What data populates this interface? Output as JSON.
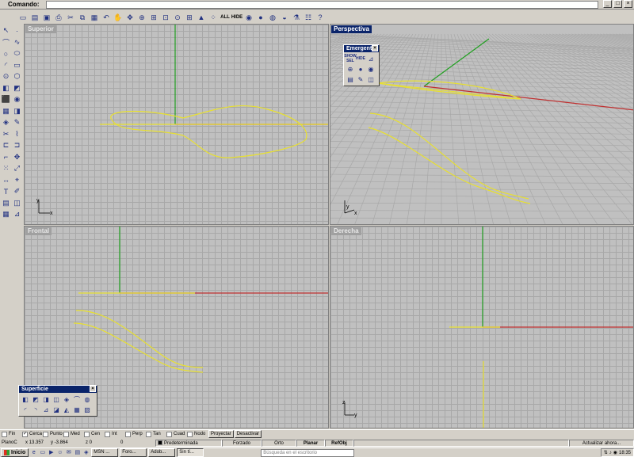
{
  "command": {
    "label": "Comando:",
    "value": ""
  },
  "window_buttons": [
    "_",
    "□",
    "×"
  ],
  "toolbar": {
    "icons": [
      {
        "name": "new-file-icon",
        "glyph": "▭"
      },
      {
        "name": "open-folder-icon",
        "glyph": "▤"
      },
      {
        "name": "save-icon",
        "glyph": "▣"
      },
      {
        "name": "print-icon",
        "glyph": "⎙"
      },
      {
        "name": "cut-icon",
        "glyph": "✂"
      },
      {
        "name": "copy-icon",
        "glyph": "⧉"
      },
      {
        "name": "paste-icon",
        "glyph": "▦"
      },
      {
        "name": "undo-icon",
        "glyph": "↶"
      },
      {
        "name": "pan-hand-icon",
        "glyph": "✋"
      },
      {
        "name": "rotate-view-icon",
        "glyph": "✥"
      },
      {
        "name": "zoom-icon",
        "glyph": "⊕"
      },
      {
        "name": "zoom-window-icon",
        "glyph": "⊞"
      },
      {
        "name": "zoom-extents-icon",
        "glyph": "⊡"
      },
      {
        "name": "zoom-selected-icon",
        "glyph": "⊙"
      },
      {
        "name": "viewport-layout-icon",
        "glyph": "⊞"
      },
      {
        "name": "select-car-icon",
        "glyph": "▲"
      },
      {
        "name": "select-points-icon",
        "glyph": "⁘"
      },
      {
        "name": "select-all-text",
        "text": "ALL"
      },
      {
        "name": "hide-text",
        "text": "HIDE"
      },
      {
        "name": "layer-color-icon",
        "glyph": "◉"
      },
      {
        "name": "render-sphere-icon",
        "glyph": "●"
      },
      {
        "name": "render-settings-icon",
        "glyph": "◍"
      },
      {
        "name": "light-icon",
        "glyph": "◒"
      },
      {
        "name": "flask-icon",
        "glyph": "⚗"
      },
      {
        "name": "options-icon",
        "glyph": "☷"
      },
      {
        "name": "help-icon",
        "glyph": "?"
      }
    ]
  },
  "left_tools": [
    {
      "name": "select-arrow-icon",
      "glyph": "↖"
    },
    {
      "name": "point-icon",
      "glyph": "·"
    },
    {
      "name": "polyline-icon",
      "glyph": "⌒"
    },
    {
      "name": "curve-icon",
      "glyph": "∿"
    },
    {
      "name": "circle-icon",
      "glyph": "○"
    },
    {
      "name": "ellipse-icon",
      "glyph": "⬭"
    },
    {
      "name": "arc-icon",
      "glyph": "◜"
    },
    {
      "name": "rectangle-icon",
      "glyph": "▭"
    },
    {
      "name": "circle-center-icon",
      "glyph": "⊙"
    },
    {
      "name": "polygon-icon",
      "glyph": "⬡"
    },
    {
      "name": "surface-icon",
      "glyph": "◧"
    },
    {
      "name": "sweep-icon",
      "glyph": "◩"
    },
    {
      "name": "box-icon",
      "glyph": "⬛"
    },
    {
      "name": "solid-icon",
      "glyph": "◉"
    },
    {
      "name": "mesh-icon",
      "glyph": "▦"
    },
    {
      "name": "boolean-icon",
      "glyph": "◨"
    },
    {
      "name": "render-icon",
      "glyph": "◈"
    },
    {
      "name": "edit-tools-icon",
      "glyph": "✎"
    },
    {
      "name": "trim-icon",
      "glyph": "✂"
    },
    {
      "name": "split-icon",
      "glyph": "⌇"
    },
    {
      "name": "join-icon",
      "glyph": "⊏"
    },
    {
      "name": "explode-icon",
      "glyph": "⊐"
    },
    {
      "name": "fillet-icon",
      "glyph": "⌐"
    },
    {
      "name": "move-icon",
      "glyph": "✥"
    },
    {
      "name": "array-icon",
      "glyph": "⁙"
    },
    {
      "name": "scale-icon",
      "glyph": "⤢"
    },
    {
      "name": "dimension-icon",
      "glyph": "↔"
    },
    {
      "name": "analyze-icon",
      "glyph": "⌖"
    },
    {
      "name": "text-icon",
      "glyph": "T"
    },
    {
      "name": "annotation-icon",
      "glyph": "✐"
    },
    {
      "name": "properties-icon",
      "glyph": "▤"
    },
    {
      "name": "layers-icon",
      "glyph": "◫"
    },
    {
      "name": "grid-icon",
      "glyph": "▦"
    },
    {
      "name": "cplane-icon",
      "glyph": "⊿"
    }
  ],
  "viewports": {
    "top": {
      "title": "Superior"
    },
    "perspective": {
      "title": "Perspectiva"
    },
    "front": {
      "title": "Frontal"
    },
    "right": {
      "title": "Derecha"
    }
  },
  "axis_labels": {
    "x": "x",
    "y": "y",
    "z": "z"
  },
  "popup_palette": {
    "title": "Emergente",
    "show_sel": "SHOW SEL",
    "hide": "HIDE"
  },
  "surface_palette": {
    "title": "Superficie"
  },
  "osnap": {
    "items": [
      {
        "label": "Fin",
        "checked": false
      },
      {
        "label": "Cerca",
        "checked": true
      },
      {
        "label": "Punto",
        "checked": false
      },
      {
        "label": "Med",
        "checked": false
      },
      {
        "label": "Cen",
        "checked": false
      },
      {
        "label": "Int",
        "checked": false
      },
      {
        "label": "Perp",
        "checked": false
      },
      {
        "label": "Tan",
        "checked": false
      },
      {
        "label": "Cuad",
        "checked": false
      },
      {
        "label": "Nodo",
        "checked": false
      }
    ],
    "project_label": "Proyectar",
    "disable_label": "Desactivar"
  },
  "status": {
    "cplane": "PlanoC",
    "x": "x 13.357",
    "y": "y -3.864",
    "z": "z 0",
    "value": "0",
    "layer": "Predeterminada",
    "forced": "Forzado",
    "ortho": "Orto",
    "planar": "Planar",
    "refobj": "RefObj",
    "update": "Actualizar ahora..."
  },
  "taskbar": {
    "start": "Inicio",
    "tasks": [
      "MSN ...",
      "Foro...",
      "Adob...",
      "Sin tí..."
    ],
    "search_placeholder": "Búsqueda en el escritorio",
    "clock": "18:35"
  }
}
